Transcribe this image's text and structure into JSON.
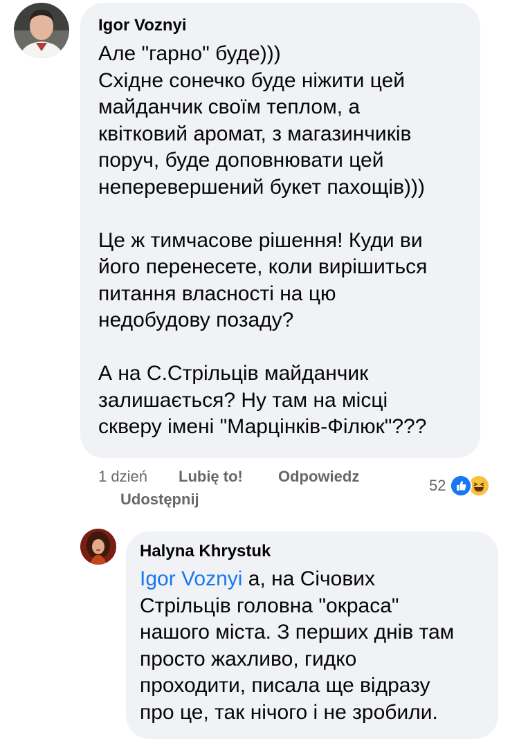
{
  "comment1": {
    "author": "Igor Voznyi",
    "paragraphs": [
      [
        "Але \"гарно\" буде)))",
        "Східне сонечко буде ніжити цей",
        "майданчик своїм теплом, а",
        "квітковий аромат, з магазинчиків",
        "поруч, буде доповнювати цей",
        "неперевершений букет пахощів)))"
      ],
      [
        "Це ж тимчасове рішення! Куди ви",
        "його перенесете, коли вирішиться",
        "питання власності на цю",
        "недобудову позаду?"
      ],
      [
        "А на С.Стрільців майданчик",
        "залишається? Ну там на місці",
        "скверу імені \"Марцінків-Філюк\"???"
      ]
    ],
    "actions": {
      "time": "1 dzień",
      "like": "Lubię to!",
      "reply": "Odpowiedz",
      "share": "Udostępnij"
    },
    "reactions": {
      "count": "52",
      "icons": [
        "like-icon",
        "haha-icon"
      ]
    }
  },
  "comment2": {
    "author": "Halyna Khrystuk",
    "mention": "Igor Voznyi",
    "lines": [
      " а, на Січових",
      "Стрільців головна \"окраса\"",
      "нашого міста. З перших днів там",
      "просто жахливо, гидко",
      "проходити, писала ще відразу",
      "про це, так нічого і не зробили."
    ]
  },
  "colors": {
    "bubble": "#f0f2f5",
    "text": "#050505",
    "secondary": "#65676b",
    "mention": "#1877f2",
    "like": "#1877f2",
    "haha": "#f7b125"
  }
}
